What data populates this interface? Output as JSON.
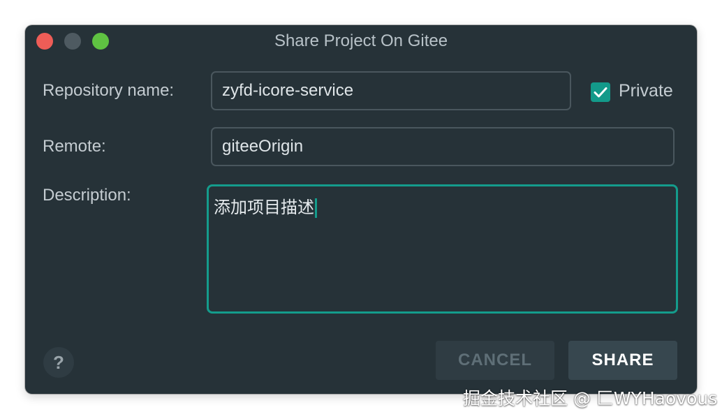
{
  "window": {
    "title": "Share Project On Gitee"
  },
  "form": {
    "repository_label": "Repository name:",
    "repository_value": "zyfd-icore-service",
    "private_label": "Private",
    "private_checked": true,
    "remote_label": "Remote:",
    "remote_value": "giteeOrigin",
    "description_label": "Description:",
    "description_value": "添加项目描述"
  },
  "footer": {
    "help_label": "?",
    "cancel_label": "CANCEL",
    "share_label": "SHARE"
  },
  "watermark": {
    "text": "掘金技术社区 @ 匚WYHaovous"
  },
  "colors": {
    "window_bg": "#263238",
    "accent": "#149c8c",
    "close": "#ee5d57",
    "minimize": "#4e5a61",
    "zoom": "#5fc242"
  },
  "icons": {
    "checkbox": "checkmark-icon",
    "help": "question-icon"
  }
}
